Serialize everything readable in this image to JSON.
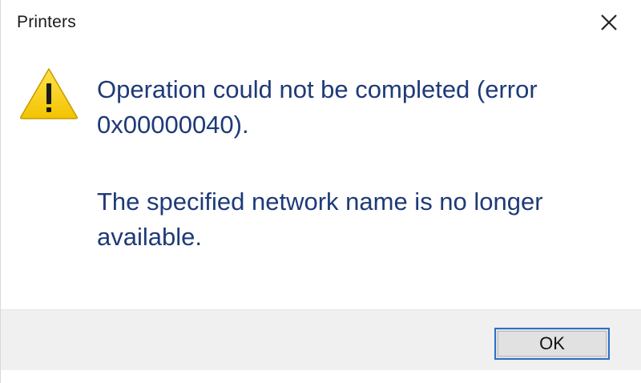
{
  "window": {
    "title": "Printers",
    "close_icon": "close-icon"
  },
  "message": {
    "icon": "warning-icon",
    "accent_color": "#1e3a78",
    "icon_color": "#f5d000",
    "line1": "Operation could not be completed (error 0x00000040).",
    "line2": "The specified network name is no longer available."
  },
  "buttons": {
    "ok_label": "OK"
  }
}
